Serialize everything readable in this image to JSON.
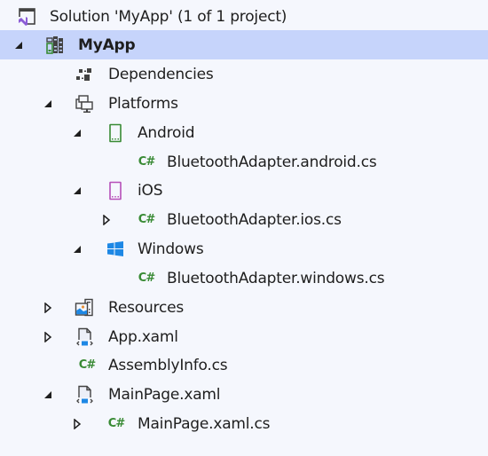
{
  "solution_explorer": {
    "solution": {
      "label": "Solution 'MyApp' (1 of 1 project)",
      "icon": "solution-icon"
    },
    "project": {
      "label": "MyApp",
      "icon": "project-icon",
      "expanded": true,
      "selected": true
    },
    "items": {
      "dependencies": {
        "label": "Dependencies",
        "icon": "dependencies-icon"
      },
      "platforms": {
        "label": "Platforms",
        "icon": "platforms-icon",
        "expanded": true
      },
      "android": {
        "label": "Android",
        "icon": "android-device-icon",
        "expanded": true
      },
      "bt_android": {
        "label": "BluetoothAdapter.android.cs",
        "icon": "csharp-file-icon",
        "icon_text": "C#"
      },
      "ios": {
        "label": "iOS",
        "icon": "ios-device-icon",
        "expanded": true
      },
      "bt_ios": {
        "label": "BluetoothAdapter.ios.cs",
        "icon": "csharp-file-icon",
        "icon_text": "C#",
        "expanded": false
      },
      "windows": {
        "label": "Windows",
        "icon": "windows-logo-icon",
        "expanded": true
      },
      "bt_windows": {
        "label": "BluetoothAdapter.windows.cs",
        "icon": "csharp-file-icon",
        "icon_text": "C#"
      },
      "resources": {
        "label": "Resources",
        "icon": "resources-icon",
        "expanded": false
      },
      "app_xaml": {
        "label": "App.xaml",
        "icon": "xaml-file-icon",
        "expanded": false
      },
      "assembly_info": {
        "label": "AssemblyInfo.cs",
        "icon": "csharp-file-icon",
        "icon_text": "C#"
      },
      "main_page_xaml": {
        "label": "MainPage.xaml",
        "icon": "xaml-file-icon",
        "expanded": true
      },
      "main_page_xaml_cs": {
        "label": "MainPage.xaml.cs",
        "icon": "csharp-file-icon",
        "icon_text": "C#",
        "expanded": false
      }
    },
    "colors": {
      "background": "#f5f7fd",
      "selection": "#c6d4fb",
      "csharp": "#388a34",
      "android": "#388a34",
      "ios": "#b64fb8",
      "windows": "#1e88e5",
      "visual_studio": "#8b5cd6"
    }
  }
}
